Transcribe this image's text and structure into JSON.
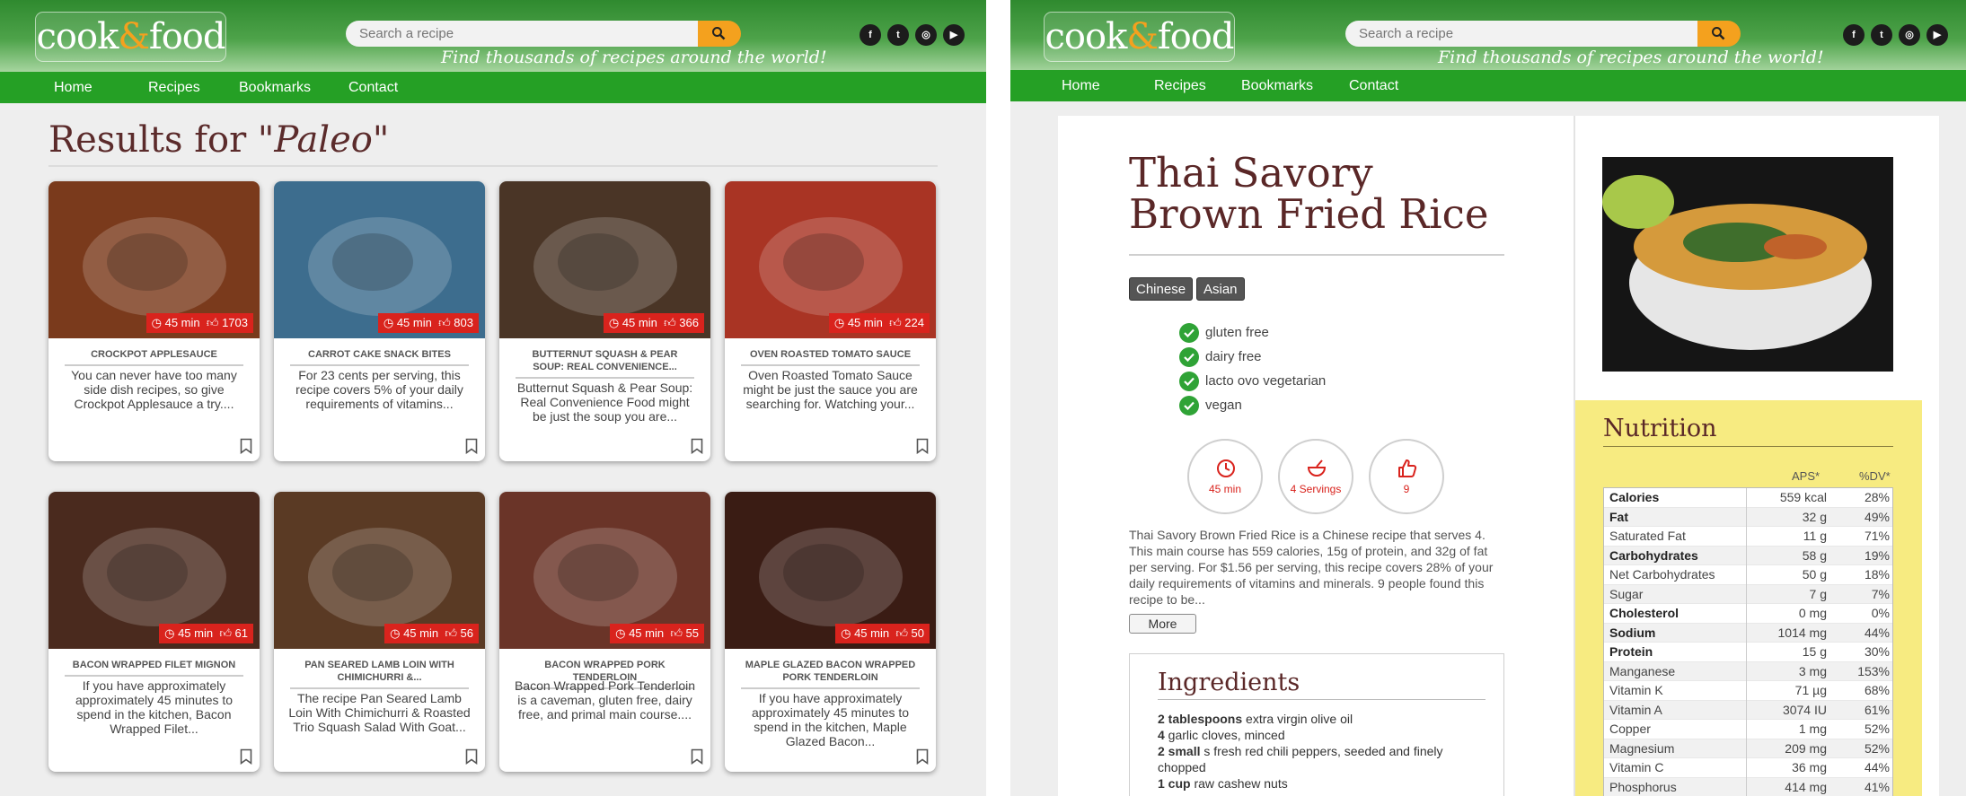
{
  "site": {
    "logo_left": "cook",
    "logo_amp": "&",
    "logo_right": "food",
    "search_placeholder": "Search a recipe",
    "tagline": "Find thousands of recipes around the world!",
    "social_icons": [
      "facebook-icon",
      "twitter-icon",
      "instagram-icon",
      "youtube-icon"
    ],
    "social_glyphs": [
      "f",
      "t",
      "◎",
      "▶"
    ],
    "nav": [
      "Home",
      "Recipes",
      "Bookmarks",
      "Contact"
    ],
    "colors": {
      "header_green": "#2f8a2f",
      "nav_green": "#25a025",
      "accent_orange": "#f4a11e",
      "meta_red": "#d9231d",
      "nutrition_yellow": "#f7eb81",
      "title_maroon": "#5b2b2b"
    }
  },
  "results": {
    "prefix": "Results for ",
    "query": "\"Paleo\"",
    "cards": [
      {
        "time": "45 min",
        "likes": "1703",
        "title": "CROCKPOT APPLESAUCE",
        "desc": "You can never have too many side dish recipes, so give Crockpot Applesauce a try....",
        "photo_color": "#7a3a1c"
      },
      {
        "time": "45 min",
        "likes": "803",
        "title": "CARROT CAKE SNACK BITES",
        "desc": "For 23 cents per serving, this recipe covers 5% of your daily requirements of vitamins...",
        "photo_color": "#3d6d8e"
      },
      {
        "time": "45 min",
        "likes": "366",
        "title": "BUTTERNUT SQUASH & PEAR SOUP: REAL CONVENIENCE...",
        "desc": "Butternut Squash & Pear Soup: Real Convenience Food might be just the soup you are...",
        "photo_color": "#4a3526"
      },
      {
        "time": "45 min",
        "likes": "224",
        "title": "OVEN ROASTED TOMATO SAUCE",
        "desc": "Oven Roasted Tomato Sauce might be just the sauce you are searching for. Watching your...",
        "photo_color": "#a93424"
      },
      {
        "time": "45 min",
        "likes": "61",
        "title": "BACON WRAPPED FILET MIGNON",
        "desc": "If you have approximately approximately 45 minutes to spend in the kitchen, Bacon Wrapped Filet...",
        "photo_color": "#4a2a1e"
      },
      {
        "time": "45 min",
        "likes": "56",
        "title": "PAN SEARED LAMB LOIN WITH CHIMICHURRI &...",
        "desc": "The recipe Pan Seared Lamb Loin With Chimichurri & Roasted Trio Squash Salad With Goat...",
        "photo_color": "#5a3a24"
      },
      {
        "time": "45 min",
        "likes": "55",
        "title": "BACON WRAPPED PORK TENDERLOIN",
        "desc": "Bacon Wrapped Pork Tenderloin is a caveman, gluten free, dairy free, and primal main course....",
        "photo_color": "#6a3428"
      },
      {
        "time": "45 min",
        "likes": "50",
        "title": "MAPLE GLAZED BACON WRAPPED PORK TENDERLOIN",
        "desc": "If you have approximately approximately 45 minutes to spend in the kitchen, Maple Glazed Bacon...",
        "photo_color": "#3a1c14"
      }
    ]
  },
  "recipe": {
    "title": "Thai Savory Brown Fried Rice",
    "tags": [
      "Chinese",
      "Asian"
    ],
    "diets": [
      "gluten free",
      "dairy free",
      "lacto ovo vegetarian",
      "vegan"
    ],
    "time": "45 min",
    "servings": "4 Servings",
    "likes": "9",
    "summary": "Thai Savory Brown Fried Rice is a Chinese recipe that serves 4. This main course has 559 calories, 15g of protein, and 32g of fat per serving. For $1.56 per serving, this recipe covers 28% of your daily requirements of vitamins and minerals. 9 people found this recipe to be...",
    "more_label": "More",
    "ingredients_heading": "Ingredients",
    "ingredients": [
      {
        "qty": "2 tablespoons",
        "text": " extra virgin olive oil"
      },
      {
        "qty": "4",
        "text": " garlic cloves, minced"
      },
      {
        "qty": "2 small",
        "text": " s fresh red chili peppers, seeded and finely chopped"
      },
      {
        "qty": "1 cup",
        "text": " raw cashew nuts"
      }
    ],
    "nutrition_heading": "Nutrition",
    "nutrition_cols": [
      "APS*",
      "%DV*"
    ],
    "nutrition": [
      {
        "name": "Calories",
        "amount": "559 kcal",
        "dv": "28%",
        "bold": true
      },
      {
        "name": "Fat",
        "amount": "32 g",
        "dv": "49%",
        "bold": true
      },
      {
        "name": "Saturated Fat",
        "amount": "11 g",
        "dv": "71%",
        "bold": false
      },
      {
        "name": "Carbohydrates",
        "amount": "58 g",
        "dv": "19%",
        "bold": true
      },
      {
        "name": "Net Carbohydrates",
        "amount": "50 g",
        "dv": "18%",
        "bold": false
      },
      {
        "name": "Sugar",
        "amount": "7 g",
        "dv": "7%",
        "bold": false
      },
      {
        "name": "Cholesterol",
        "amount": "0 mg",
        "dv": "0%",
        "bold": true
      },
      {
        "name": "Sodium",
        "amount": "1014 mg",
        "dv": "44%",
        "bold": true
      },
      {
        "name": "Protein",
        "amount": "15 g",
        "dv": "30%",
        "bold": true
      },
      {
        "name": "Manganese",
        "amount": "3 mg",
        "dv": "153%",
        "bold": false
      },
      {
        "name": "Vitamin K",
        "amount": "71 µg",
        "dv": "68%",
        "bold": false
      },
      {
        "name": "Vitamin A",
        "amount": "3074 IU",
        "dv": "61%",
        "bold": false
      },
      {
        "name": "Copper",
        "amount": "1 mg",
        "dv": "52%",
        "bold": false
      },
      {
        "name": "Magnesium",
        "amount": "209 mg",
        "dv": "52%",
        "bold": false
      },
      {
        "name": "Vitamin C",
        "amount": "36 mg",
        "dv": "44%",
        "bold": false
      },
      {
        "name": "Phosphorus",
        "amount": "414 mg",
        "dv": "41%",
        "bold": false
      }
    ]
  }
}
